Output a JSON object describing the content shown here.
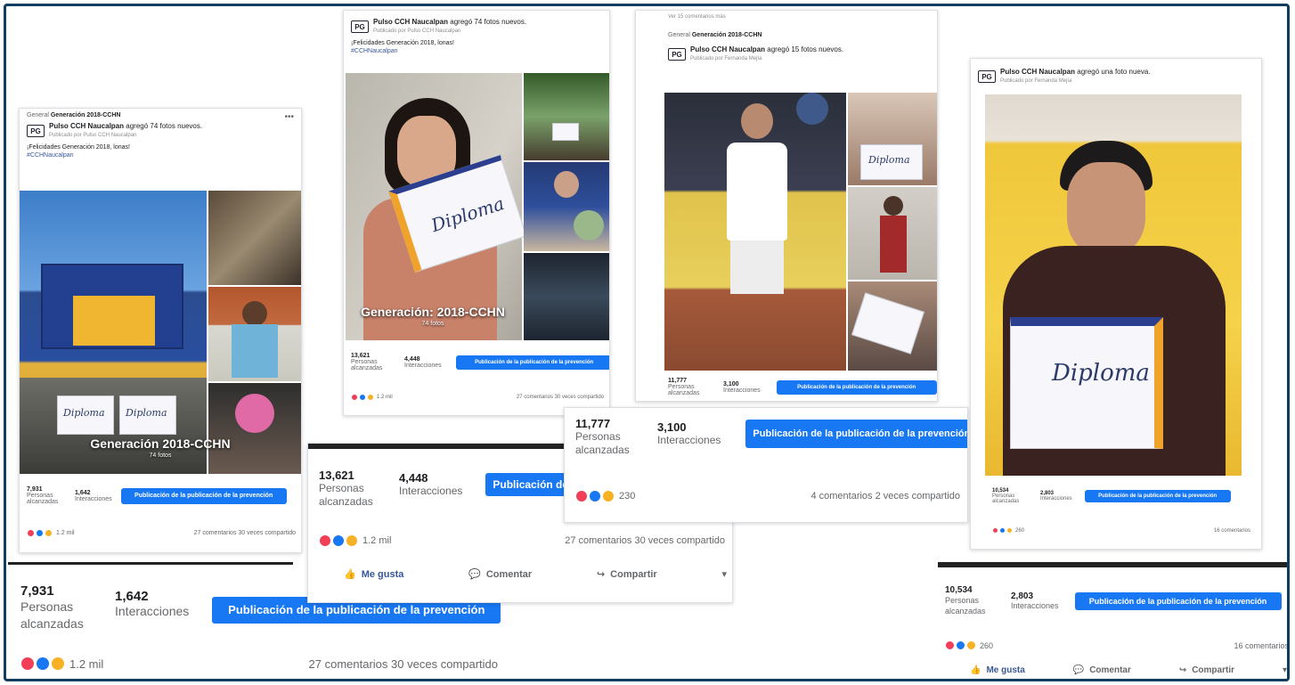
{
  "posts": {
    "p1": {
      "group": "Generación 2018-CCHN",
      "author": "Pulso CCH Naucalpan",
      "action": "agregó 74 fotos nuevos.",
      "published_by": "Publicado por Pulso CCH Naucalpan",
      "caption": "¡Felicidades Generación 2018, lonas!",
      "hashtag": "#CCHNaucalpan",
      "overlay_title": "Generación 2018-CCHN",
      "overlay_sub": "74 fotos",
      "reach": "7,931",
      "reach_label": "Personas alcanzadas",
      "interactions": "1,642",
      "interactions_label": "Interacciones",
      "promo": "Publicación de la publicación de la prevención",
      "reactions": "1.2 mil",
      "comments": "27 comentarios",
      "shares": "30 veces compartido"
    },
    "p2": {
      "author": "Pulso CCH Naucalpan",
      "action": "agregó 74 fotos nuevos.",
      "published_by": "Publicado por Pulso CCH Naucalpan",
      "caption": "¡Felicidades Generación 2018, lonas!",
      "hashtag": "#CCHNaucalpan",
      "overlay_title": "Generación: 2018-CCHN",
      "overlay_sub": "74 fotos",
      "reach": "13,621",
      "reach_label": "Personas alcanzadas",
      "interactions": "4,448",
      "interactions_label": "Interacciones",
      "promo": "Publicación de la publicación de la prevención",
      "reactions": "1.2 mil",
      "comments": "27 comentarios",
      "shares": "30 veces compartido",
      "like": "Me gusta",
      "comment": "Comentar",
      "share": "Compartir"
    },
    "p3": {
      "top_note": "Ver 15 comentarios más",
      "group": "Generación 2018-CCHN",
      "author": "Pulso CCH Naucalpan",
      "action": "agregó 15 fotos nuevos.",
      "published_by": "Publicado por Fernanda Mejía",
      "reach": "11,777",
      "reach_label": "Personas alcanzadas",
      "interactions": "3,100",
      "interactions_label": "Interacciones",
      "promo": "Publicación de la publicación de la prevención",
      "reactions": "230",
      "comments": "4 comentarios",
      "shares": "2 veces compartido"
    },
    "p4": {
      "author": "Pulso CCH Naucalpan",
      "action": "agregó una foto nueva.",
      "published_by": "Publicado por Fernanda Mejía",
      "reach": "10,534",
      "reach_label": "Personas alcanzadas",
      "interactions": "2,803",
      "interactions_label": "Interacciones",
      "promo": "Publicación de la publicación de la prevención",
      "reactions": "260",
      "comments": "16 comentarios",
      "like": "Me gusta",
      "comment": "Comentar",
      "share": "Compartir"
    }
  },
  "diploma_word": "Diploma",
  "colors": {
    "facebook_blue": "#1877f2",
    "frame": "#123c5e"
  }
}
